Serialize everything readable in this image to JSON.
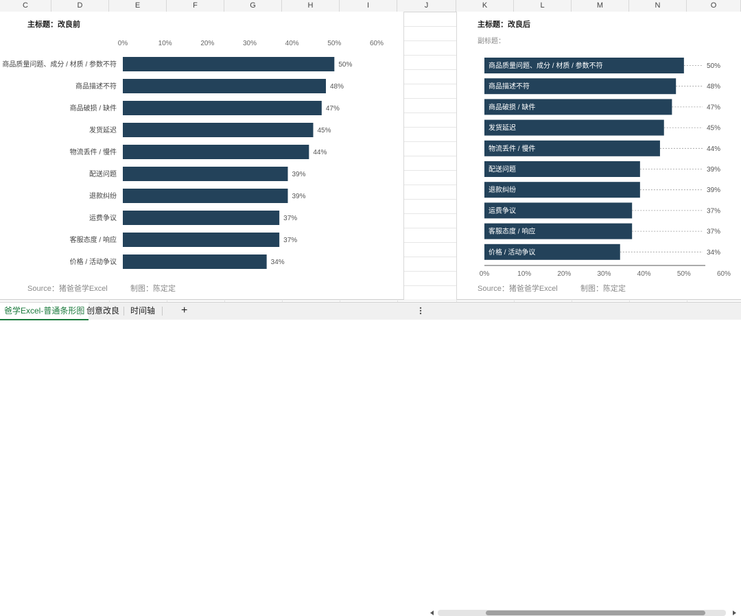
{
  "columns": [
    "C",
    "D",
    "E",
    "F",
    "G",
    "H",
    "I",
    "J",
    "K",
    "L",
    "M",
    "N",
    "O"
  ],
  "left_panel": {
    "title": "主标题：改良前",
    "source": "Source：猪爸爸学Excel",
    "credit": "制图：陈定定"
  },
  "right_panel": {
    "title": "主标题：改良后",
    "subtitle": "副标题：",
    "source": "Source：猪爸爸学Excel",
    "credit": "制图：陈定定"
  },
  "chart_data": [
    {
      "type": "bar",
      "orientation": "horizontal",
      "title": "主标题：改良前",
      "categories": [
        "商品质量问题、成分 / 材质 / 参数不符",
        "商品描述不符",
        "商品破损 / 缺件",
        "发货延迟",
        "物流丢件 / 慢件",
        "配送问题",
        "退款纠纷",
        "运费争议",
        "客服态度 / 响应",
        "价格 / 活动争议"
      ],
      "values": [
        50,
        48,
        47,
        45,
        44,
        39,
        39,
        37,
        37,
        34
      ],
      "data_labels": [
        "50%",
        "48%",
        "47%",
        "45%",
        "44%",
        "39%",
        "39%",
        "37%",
        "37%",
        "34%"
      ],
      "xaxis_ticks": [
        "0%",
        "10%",
        "20%",
        "30%",
        "40%",
        "50%",
        "60%"
      ],
      "xlim": [
        0,
        60
      ],
      "axis_position": "top",
      "category_label_position": "outside-left",
      "bar_color": "#23425a"
    },
    {
      "type": "bar",
      "orientation": "horizontal",
      "title": "主标题：改良后",
      "categories": [
        "商品质量问题、成分 / 材质 / 参数不符",
        "商品描述不符",
        "商品破损 / 缺件",
        "发货延迟",
        "物流丢件 / 慢件",
        "配送问题",
        "退款纠纷",
        "运费争议",
        "客服态度 / 响应",
        "价格 / 活动争议"
      ],
      "values": [
        50,
        48,
        47,
        45,
        44,
        39,
        39,
        37,
        37,
        34
      ],
      "data_labels": [
        "50%",
        "48%",
        "47%",
        "45%",
        "44%",
        "39%",
        "39%",
        "37%",
        "37%",
        "34%"
      ],
      "xaxis_ticks": [
        "0%",
        "10%",
        "20%",
        "30%",
        "40%",
        "50%",
        "60%"
      ],
      "xlim": [
        0,
        60
      ],
      "axis_position": "bottom",
      "category_label_position": "inside-bar",
      "leader_lines": true,
      "bar_color": "#23425a"
    }
  ],
  "tabs": [
    {
      "label": "爸学Excel-普通条形图",
      "active": true
    },
    {
      "label": "创意改良",
      "active": false
    },
    {
      "label": "时间轴",
      "active": false
    }
  ],
  "add_tab_label": "+"
}
